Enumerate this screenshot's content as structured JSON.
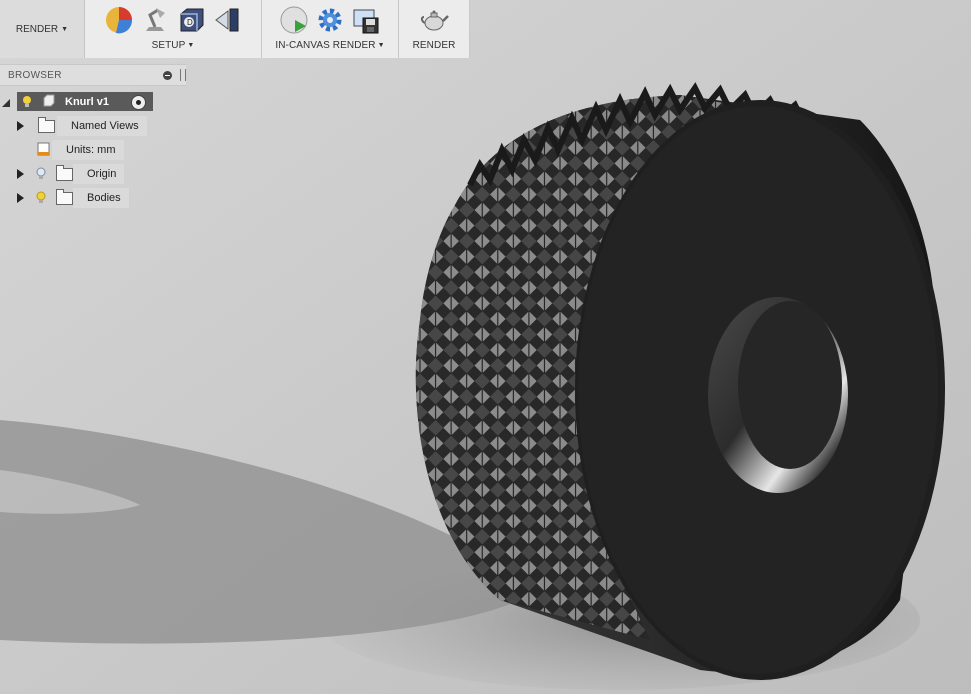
{
  "toolbar": {
    "workspace_label": "RENDER",
    "groups": [
      {
        "label": "SETUP",
        "icons": [
          "appearance-icon",
          "scene-settings-icon",
          "texture-map-icon",
          "decal-icon"
        ]
      },
      {
        "label": "IN-CANVAS RENDER",
        "icons": [
          "in-canvas-render-icon",
          "render-settings-icon",
          "capture-image-icon"
        ]
      },
      {
        "label": "RENDER",
        "icons": [
          "render-teapot-icon"
        ]
      }
    ]
  },
  "browser": {
    "title": "BROWSER",
    "root": {
      "label": "Knurl v1"
    },
    "items": [
      {
        "label": "Named Views"
      },
      {
        "label": "Units: mm"
      },
      {
        "label": "Origin"
      },
      {
        "label": "Bodies"
      }
    ]
  },
  "colors": {
    "toolbar_bg": "#ececec",
    "canvas_bg": "#cfcfcf",
    "root_row_bg": "#5a5a5a",
    "model": "#1e1e1e"
  }
}
